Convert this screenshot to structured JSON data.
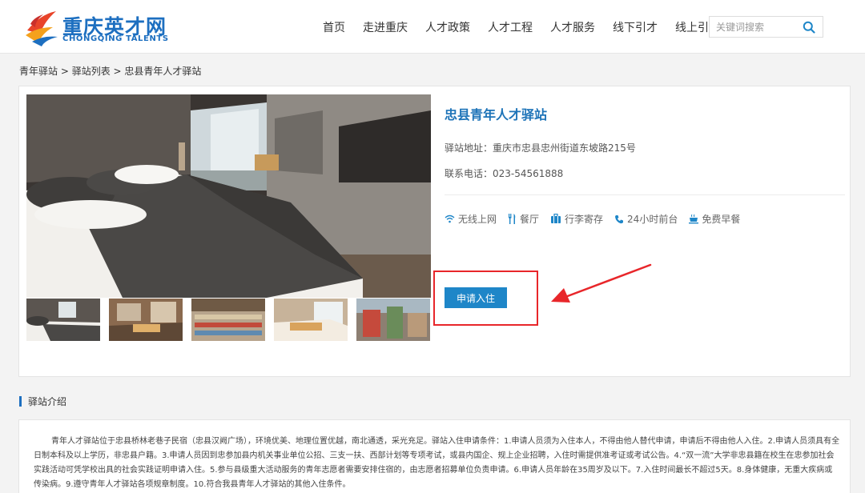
{
  "header": {
    "logo_cn": "重庆英才网",
    "logo_en": "CHONGQING TALENTS",
    "nav": [
      "首页",
      "走进重庆",
      "人才政策",
      "人才工程",
      "人才服务",
      "线下引才",
      "线上引才"
    ],
    "search_placeholder": "关键词搜索"
  },
  "breadcrumb": {
    "items": [
      "青年驿站",
      "驿站列表",
      "忠县青年人才驿站"
    ],
    "separator": " > "
  },
  "station": {
    "title": "忠县青年人才驿站",
    "address": "驿站地址：重庆市忠县忠州街道东坡路215号",
    "phone": "联系电话：023-54561888",
    "amenities": [
      "无线上网",
      "餐厅",
      "行李寄存",
      "24小时前台",
      "免费早餐"
    ],
    "apply_label": "申请入住"
  },
  "intro": {
    "title": "驿站介绍",
    "text": "青年人才驿站位于忠县桥林老巷子民宿（忠县汉阙广场），环境优美、地理位置优越，南北通透，采光充足。驿站入住申请条件：1.申请人员须为入住本人，不得由他人替代申请，申请后不得由他人入住。2.申请人员须具有全日制本科及以上学历，非忠县户籍。3.申请人员因到忠参加县内机关事业单位公招、三支一扶、西部计划等专项考试，或县内国企、规上企业招聘，入住时需提供准考证或考试公告。4.“双一流”大学非忠县籍在校生在忠参加社会实践活动可凭学校出具的社会实践证明申请入住。5.参与县级重大活动服务的青年志愿者需要安排住宿的，由志愿者招募单位负责申请。6.申请人员年龄在35周岁及以下。7.入住时间最长不超过5天。8.身体健康，无重大疾病或传染病。9.遵守青年人才驿站各项规章制度。10.符合我县青年人才驿站的其他入住条件。"
  },
  "colors": {
    "accent": "#1d73b8",
    "button": "#1e86c8",
    "annotation": "#e8262a"
  }
}
